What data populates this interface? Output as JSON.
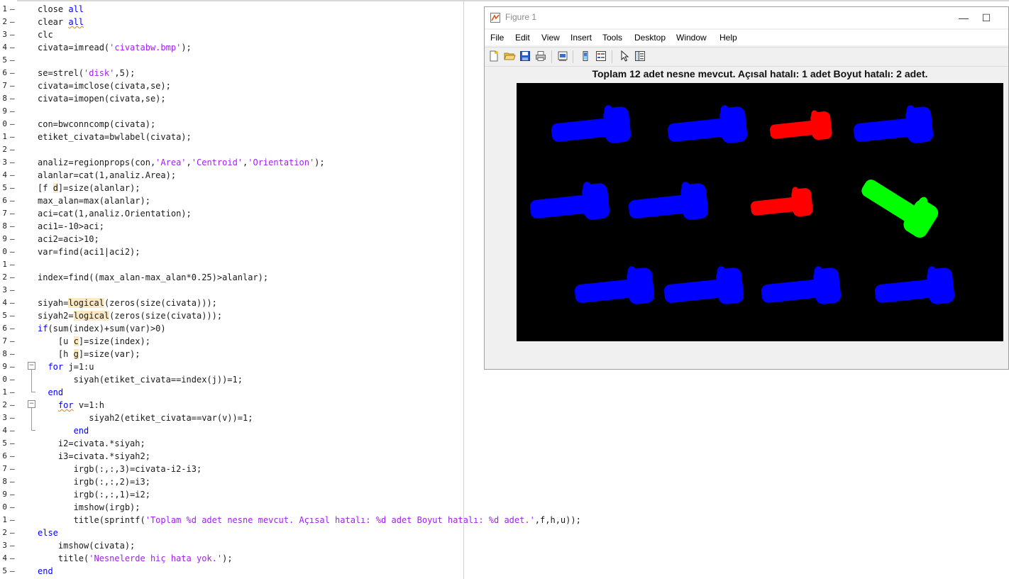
{
  "editor": {
    "lines": [
      {
        "n": "1",
        "segs": [
          [
            "t",
            "close "
          ],
          [
            "kw",
            "all"
          ]
        ]
      },
      {
        "n": "2",
        "segs": [
          [
            "t",
            "clear "
          ],
          [
            "kwsq",
            "all"
          ]
        ]
      },
      {
        "n": "3",
        "segs": [
          [
            "t",
            "clc"
          ]
        ]
      },
      {
        "n": "4",
        "segs": [
          [
            "t",
            "civata=imread("
          ],
          [
            "str",
            "'civatabw.bmp'"
          ],
          [
            "t",
            ");"
          ]
        ]
      },
      {
        "n": "5",
        "segs": []
      },
      {
        "n": "6",
        "segs": [
          [
            "t",
            "se=strel("
          ],
          [
            "str",
            "'disk'"
          ],
          [
            "t",
            ",5);"
          ]
        ]
      },
      {
        "n": "7",
        "segs": [
          [
            "t",
            "civata=imclose(civata,se);"
          ]
        ]
      },
      {
        "n": "8",
        "segs": [
          [
            "t",
            "civata=imopen(civata,se);"
          ]
        ]
      },
      {
        "n": "9",
        "segs": []
      },
      {
        "n": "0",
        "segs": [
          [
            "t",
            "con=bwconncomp(civata);"
          ]
        ]
      },
      {
        "n": "1",
        "segs": [
          [
            "t",
            "etiket_civata=bwlabel(civata);"
          ]
        ]
      },
      {
        "n": "2",
        "segs": []
      },
      {
        "n": "3",
        "segs": [
          [
            "t",
            "analiz=regionprops(con,"
          ],
          [
            "str",
            "'Area'"
          ],
          [
            "t",
            ","
          ],
          [
            "str",
            "'Centroid'"
          ],
          [
            "t",
            ","
          ],
          [
            "str",
            "'Orientation'"
          ],
          [
            "t",
            ");"
          ]
        ]
      },
      {
        "n": "4",
        "segs": [
          [
            "t",
            "alanlar=cat(1,analiz.Area);"
          ]
        ]
      },
      {
        "n": "5",
        "segs": [
          [
            "t",
            "[f "
          ],
          [
            "hl",
            "d"
          ],
          [
            "t",
            "]=size(alanlar);"
          ]
        ]
      },
      {
        "n": "6",
        "segs": [
          [
            "t",
            "max_alan=max(alanlar);"
          ]
        ]
      },
      {
        "n": "7",
        "segs": [
          [
            "t",
            "aci=cat(1,analiz.Orientation);"
          ]
        ]
      },
      {
        "n": "8",
        "segs": [
          [
            "t",
            "aci1=-10>aci;"
          ]
        ]
      },
      {
        "n": "9",
        "segs": [
          [
            "t",
            "aci2=aci>10;"
          ]
        ]
      },
      {
        "n": "0",
        "segs": [
          [
            "t",
            "var=find(aci1|aci2);"
          ]
        ]
      },
      {
        "n": "1",
        "segs": []
      },
      {
        "n": "2",
        "segs": [
          [
            "t",
            "index=find((max_alan-max_alan*0.25)>alanlar);"
          ]
        ]
      },
      {
        "n": "3",
        "segs": []
      },
      {
        "n": "4",
        "segs": [
          [
            "t",
            "siyah="
          ],
          [
            "hl",
            "logical"
          ],
          [
            "t",
            "(zeros(size(civata)));"
          ]
        ]
      },
      {
        "n": "5",
        "segs": [
          [
            "t",
            "siyah2="
          ],
          [
            "hl",
            "logical"
          ],
          [
            "t",
            "(zeros(size(civata)));"
          ]
        ]
      },
      {
        "n": "6",
        "segs": [
          [
            "kw",
            "if"
          ],
          [
            "t",
            "(sum(index)+sum(var)>0)"
          ]
        ]
      },
      {
        "n": "7",
        "segs": [
          [
            "t",
            "    [u "
          ],
          [
            "hl",
            "c"
          ],
          [
            "t",
            "]=size(index);"
          ]
        ]
      },
      {
        "n": "8",
        "segs": [
          [
            "t",
            "    [h "
          ],
          [
            "hl",
            "g"
          ],
          [
            "t",
            "]=size(var);"
          ]
        ]
      },
      {
        "n": "9",
        "segs": [
          [
            "t",
            "  "
          ],
          [
            "kw",
            "for"
          ],
          [
            "t",
            " j=1:u"
          ]
        ]
      },
      {
        "n": "0",
        "segs": [
          [
            "t",
            "       siyah(etiket_civata==index(j))=1;"
          ]
        ]
      },
      {
        "n": "1",
        "segs": [
          [
            "t",
            "  "
          ],
          [
            "kw",
            "end"
          ]
        ]
      },
      {
        "n": "2",
        "segs": [
          [
            "t",
            "    "
          ],
          [
            "kwsq",
            "for"
          ],
          [
            "t",
            " v=1:h"
          ]
        ]
      },
      {
        "n": "3",
        "segs": [
          [
            "t",
            "          siyah2(etiket_civata==var(v))=1;"
          ]
        ]
      },
      {
        "n": "4",
        "segs": [
          [
            "t",
            "       "
          ],
          [
            "kw",
            "end"
          ]
        ]
      },
      {
        "n": "5",
        "segs": [
          [
            "t",
            "    i2=civata.*siyah;"
          ]
        ]
      },
      {
        "n": "6",
        "segs": [
          [
            "t",
            "    i3=civata.*siyah2;"
          ]
        ]
      },
      {
        "n": "7",
        "segs": [
          [
            "t",
            "       irgb(:,:,3)=civata-i2-i3;"
          ]
        ]
      },
      {
        "n": "8",
        "segs": [
          [
            "t",
            "       irgb(:,:,2)=i3;"
          ]
        ]
      },
      {
        "n": "9",
        "segs": [
          [
            "t",
            "       irgb(:,:,1)=i2;"
          ]
        ]
      },
      {
        "n": "0",
        "segs": [
          [
            "t",
            "       imshow(irgb);"
          ]
        ]
      },
      {
        "n": "1",
        "segs": [
          [
            "t",
            "       title(sprintf("
          ],
          [
            "str",
            "'Toplam %d adet nesne mevcut. Açısal hatalı: %d adet Boyut hatalı: %d adet.'"
          ],
          [
            "t",
            ",f,h,u));"
          ]
        ]
      },
      {
        "n": "2",
        "segs": [
          [
            "kw",
            "else"
          ]
        ]
      },
      {
        "n": "3",
        "segs": [
          [
            "t",
            "    imshow(civata);"
          ]
        ]
      },
      {
        "n": "4",
        "segs": [
          [
            "t",
            "    title("
          ],
          [
            "str",
            "'Nesnelerde hiç hata yok.'"
          ],
          [
            "t",
            ");"
          ]
        ]
      },
      {
        "n": "5",
        "segs": [
          [
            "kw",
            "end"
          ]
        ]
      }
    ]
  },
  "figure": {
    "window_title": "Figure 1",
    "minimize": "—",
    "maximize": "☐",
    "menu": [
      "File",
      "Edit",
      "View",
      "Insert",
      "Tools",
      "Desktop",
      "Window",
      "Help"
    ],
    "toolbar_icons": [
      "new-figure-icon",
      "open-file-icon",
      "save-icon",
      "print-icon",
      "print-preview-icon",
      "colorbar-icon",
      "legend-icon",
      "select-arrow-icon",
      "property-inspector-icon"
    ],
    "plot_title": "Toplam 12 adet nesne mevcut. Açısal hatalı: 1 adet Boyut hatalı: 2 adet.",
    "colors": {
      "ok": "#0000ff",
      "size_error": "#ff0000",
      "angle_error": "#00ff00",
      "background": "#000000"
    },
    "objects": [
      {
        "status": "ok",
        "row": 1,
        "col": 1
      },
      {
        "status": "ok",
        "row": 1,
        "col": 2
      },
      {
        "status": "size_error",
        "row": 1,
        "col": 3
      },
      {
        "status": "ok",
        "row": 1,
        "col": 4
      },
      {
        "status": "ok",
        "row": 2,
        "col": 1
      },
      {
        "status": "ok",
        "row": 2,
        "col": 2
      },
      {
        "status": "size_error",
        "row": 2,
        "col": 3
      },
      {
        "status": "angle_error",
        "row": 2,
        "col": 4
      },
      {
        "status": "ok",
        "row": 3,
        "col": 1
      },
      {
        "status": "ok",
        "row": 3,
        "col": 2
      },
      {
        "status": "ok",
        "row": 3,
        "col": 3
      },
      {
        "status": "ok",
        "row": 3,
        "col": 4
      }
    ]
  }
}
